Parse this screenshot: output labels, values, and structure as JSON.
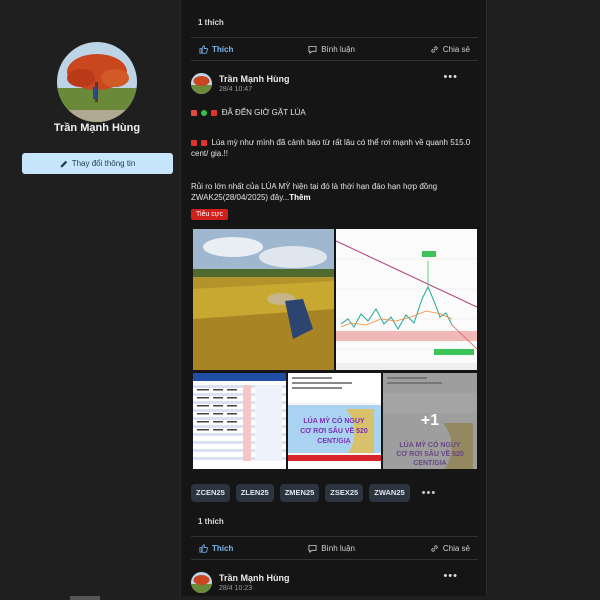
{
  "profile": {
    "name": "Trần Mạnh Hùng",
    "edit_button": "Thay đổi thông tin"
  },
  "top_post": {
    "likes": "1 thích"
  },
  "actions": {
    "like": "Thích",
    "comment": "Bình luận",
    "share": "Chia sẻ"
  },
  "post": {
    "author": "Trần Mạnh Hùng",
    "time": "28/4 10:47",
    "headline": "ĐÃ ĐẾN GIỜ GẶT LÚA",
    "line1": "Lúa mỳ như mình đã cảnh báo từ rất lâu có thể rơi mạnh về quanh 515.0 cent/ giạ.!!",
    "line2": "Rủi ro lớn nhất của LÚA MỲ hiện tại đó là thời hạn đáo hạn hợp đồng ZWAK25(28/04/2025) đây...",
    "see_more": "Thêm",
    "sentiment": "Tiêu cực",
    "image_caption_1": "LÚA MỲ CÓ NGUY CƠ RƠI SÂU VỀ 520 CENT/GIẠ",
    "image_caption_2": "LÚA MỲ CÓ NGUY CƠ RƠI SÂU VỀ 520 CENT/GIẠ",
    "more_images": "+1",
    "tags": [
      "ZCEN25",
      "ZLEN25",
      "ZMEN25",
      "ZSEX25",
      "ZWAN25"
    ],
    "tags_more": "•••",
    "likes": "1 thích"
  },
  "next_post": {
    "author": "Trần Mạnh Hùng",
    "time": "28/4 10:23"
  },
  "colors": {
    "like_blue": "#7bb6f0",
    "badge_red": "#d0201a",
    "button_bg": "#c7e6fb"
  }
}
